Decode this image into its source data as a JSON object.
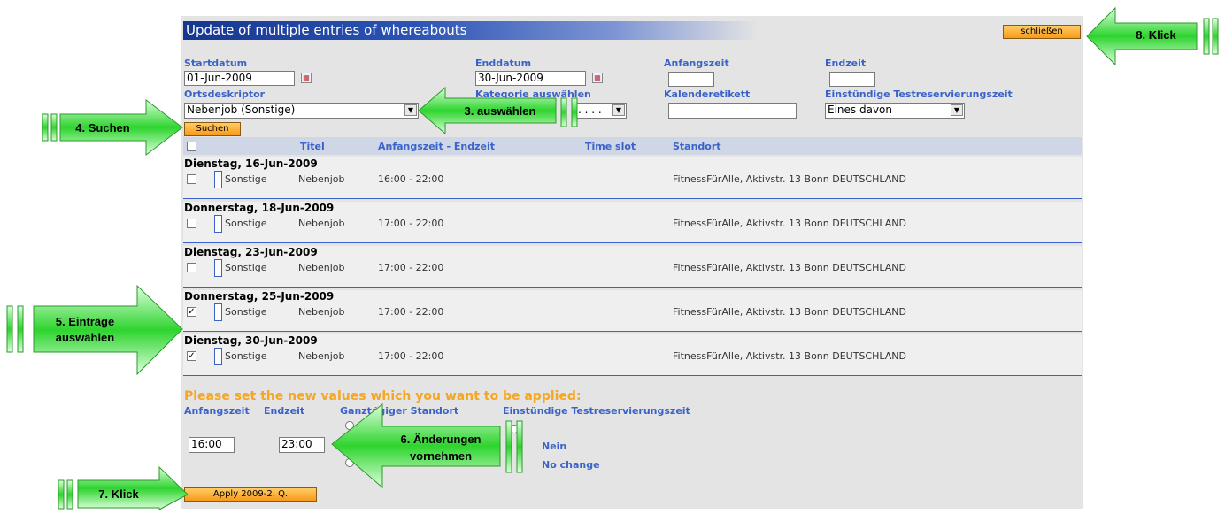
{
  "window": {
    "title": "Update of multiple entries of whereabouts",
    "close_label": "schließen"
  },
  "search": {
    "start_label": "Startdatum",
    "start_value": "01-Jun-2009",
    "end_label": "Enddatum",
    "end_value": "30-Jun-2009",
    "begin_time_label": "Anfangszeit",
    "end_time_label": "Endzeit",
    "locdesc_label": "Ortsdeskriptor",
    "locdesc_value": "Nebenjob (Sonstige)",
    "category_label": "Kategorie auswählen",
    "category_value": ". . . .",
    "calendar_label": "Kalenderetikett",
    "testslot_label": "Einstündige Testreservierungszeit",
    "testslot_value": "Eines davon",
    "search_button": "Suchen"
  },
  "table": {
    "headers": {
      "title": "Titel",
      "time": "Anfangszeit - Endzeit",
      "slot": "Time slot",
      "location": "Standort"
    },
    "days": [
      {
        "date": "Dienstag, 16-Jun-2009",
        "category": "Sonstige",
        "title": "Nebenjob",
        "time": "16:00 - 22:00",
        "location": "FitnessFürAlle, Aktivstr. 13 Bonn DEUTSCHLAND",
        "checked": ""
      },
      {
        "date": "Donnerstag, 18-Jun-2009",
        "category": "Sonstige",
        "title": "Nebenjob",
        "time": "17:00 - 22:00",
        "location": "FitnessFürAlle, Aktivstr. 13 Bonn DEUTSCHLAND",
        "checked": ""
      },
      {
        "date": "Dienstag, 23-Jun-2009",
        "category": "Sonstige",
        "title": "Nebenjob",
        "time": "17:00 - 22:00",
        "location": "FitnessFürAlle, Aktivstr. 13 Bonn DEUTSCHLAND",
        "checked": ""
      },
      {
        "date": "Donnerstag, 25-Jun-2009",
        "category": "Sonstige",
        "title": "Nebenjob",
        "time": "17:00 - 22:00",
        "location": "FitnessFürAlle, Aktivstr. 13 Bonn DEUTSCHLAND",
        "checked": "✓"
      },
      {
        "date": "Dienstag, 30-Jun-2009",
        "category": "Sonstige",
        "title": "Nebenjob",
        "time": "17:00 - 22:00",
        "location": "FitnessFürAlle, Aktivstr. 13 Bonn DEUTSCHLAND",
        "checked": "✓"
      }
    ]
  },
  "update": {
    "heading": "Please set the new values which you want to be applied:",
    "begin_label": "Anfangszeit",
    "end_label": "Endzeit",
    "allday_label": "Ganztägiger Standort",
    "testslot_label": "Einstündige Testreservierungszeit",
    "begin_value": "16:00",
    "end_value": "23:00",
    "option_no": "Nein",
    "option_nochange": "No change",
    "apply_button": "Apply 2009-2. Q."
  },
  "callouts": {
    "step3": "3. auswählen",
    "step4": "4. Suchen",
    "step5_line1": "5. Einträge",
    "step5_line2": "auswählen",
    "step6_line1": "6. Änderungen",
    "step6_line2": "vornehmen",
    "step7": "7. Klick",
    "step8": "8. Klick"
  },
  "colors": {
    "accent": "#3a62c8",
    "orange": "#f5a623",
    "callout_green": "#33cc33"
  }
}
